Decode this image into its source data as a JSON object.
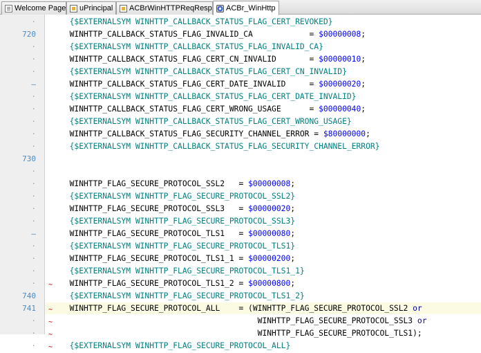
{
  "tabs": [
    {
      "label": "Welcome Page",
      "icon": "page-icon"
    },
    {
      "label": "uPrincipal",
      "icon": "unit-icon"
    },
    {
      "label": "ACBrWinHTTPReqResp",
      "icon": "unit-icon"
    },
    {
      "label": "ACBr_WinHttp",
      "icon": "gear-unit-icon",
      "active": true
    }
  ],
  "gutter": {
    "line_numbers": [
      "·",
      "720",
      "·",
      "·",
      "·",
      "–",
      "·",
      "·",
      "·",
      "·",
      "·",
      "730",
      "·",
      "·",
      "·",
      "·",
      "·",
      "–",
      "·",
      "·",
      "·",
      "·",
      "740",
      "741",
      "·",
      "·",
      "·"
    ]
  },
  "code": {
    "lines": [
      {
        "parts": [
          {
            "t": "  {$EXTERNALSYM WINHTTP_CALLBACK_STATUS_FLAG_CERT_REVOKED}",
            "c": "cm"
          }
        ]
      },
      {
        "parts": [
          {
            "t": "  WINHTTP_CALLBACK_STATUS_FLAG_INVALID_CA            = ",
            "c": ""
          },
          {
            "t": "$00000008",
            "c": "num"
          },
          {
            "t": ";",
            "c": ""
          }
        ]
      },
      {
        "parts": [
          {
            "t": "  {$EXTERNALSYM WINHTTP_CALLBACK_STATUS_FLAG_INVALID_CA}",
            "c": "cm"
          }
        ]
      },
      {
        "parts": [
          {
            "t": "  WINHTTP_CALLBACK_STATUS_FLAG_CERT_CN_INVALID       = ",
            "c": ""
          },
          {
            "t": "$00000010",
            "c": "num"
          },
          {
            "t": ";",
            "c": ""
          }
        ]
      },
      {
        "parts": [
          {
            "t": "  {$EXTERNALSYM WINHTTP_CALLBACK_STATUS_FLAG_CERT_CN_INVALID}",
            "c": "cm"
          }
        ]
      },
      {
        "parts": [
          {
            "t": "  WINHTTP_CALLBACK_STATUS_FLAG_CERT_DATE_INVALID     = ",
            "c": ""
          },
          {
            "t": "$00000020",
            "c": "num"
          },
          {
            "t": ";",
            "c": ""
          }
        ]
      },
      {
        "parts": [
          {
            "t": "  {$EXTERNALSYM WINHTTP_CALLBACK_STATUS_FLAG_CERT_DATE_INVALID}",
            "c": "cm"
          }
        ]
      },
      {
        "parts": [
          {
            "t": "  WINHTTP_CALLBACK_STATUS_FLAG_CERT_WRONG_USAGE      = ",
            "c": ""
          },
          {
            "t": "$00000040",
            "c": "num"
          },
          {
            "t": ";",
            "c": ""
          }
        ]
      },
      {
        "parts": [
          {
            "t": "  {$EXTERNALSYM WINHTTP_CALLBACK_STATUS_FLAG_CERT_WRONG_USAGE}",
            "c": "cm"
          }
        ]
      },
      {
        "parts": [
          {
            "t": "  WINHTTP_CALLBACK_STATUS_FLAG_SECURITY_CHANNEL_ERROR = ",
            "c": ""
          },
          {
            "t": "$80000000",
            "c": "num"
          },
          {
            "t": ";",
            "c": ""
          }
        ]
      },
      {
        "parts": [
          {
            "t": "  {$EXTERNALSYM WINHTTP_CALLBACK_STATUS_FLAG_SECURITY_CHANNEL_ERROR}",
            "c": "cm"
          }
        ]
      },
      {
        "parts": []
      },
      {
        "parts": []
      },
      {
        "parts": [
          {
            "t": "  WINHTTP_FLAG_SECURE_PROTOCOL_SSL2   = ",
            "c": ""
          },
          {
            "t": "$00000008",
            "c": "num"
          },
          {
            "t": ";",
            "c": ""
          }
        ]
      },
      {
        "parts": [
          {
            "t": "  {$EXTERNALSYM WINHTTP_FLAG_SECURE_PROTOCOL_SSL2}",
            "c": "cm"
          }
        ]
      },
      {
        "parts": [
          {
            "t": "  WINHTTP_FLAG_SECURE_PROTOCOL_SSL3   = ",
            "c": ""
          },
          {
            "t": "$00000020",
            "c": "num"
          },
          {
            "t": ";",
            "c": ""
          }
        ]
      },
      {
        "parts": [
          {
            "t": "  {$EXTERNALSYM WINHTTP_FLAG_SECURE_PROTOCOL_SSL3}",
            "c": "cm"
          }
        ]
      },
      {
        "parts": [
          {
            "t": "  WINHTTP_FLAG_SECURE_PROTOCOL_TLS1   = ",
            "c": ""
          },
          {
            "t": "$00000080",
            "c": "num"
          },
          {
            "t": ";",
            "c": ""
          }
        ]
      },
      {
        "parts": [
          {
            "t": "  {$EXTERNALSYM WINHTTP_FLAG_SECURE_PROTOCOL_TLS1}",
            "c": "cm"
          }
        ]
      },
      {
        "parts": [
          {
            "t": "  WINHTTP_FLAG_SECURE_PROTOCOL_TLS1_1 = ",
            "c": ""
          },
          {
            "t": "$00000200",
            "c": "num"
          },
          {
            "t": ";",
            "c": ""
          }
        ]
      },
      {
        "parts": [
          {
            "t": "  {$EXTERNALSYM WINHTTP_FLAG_SECURE_PROTOCOL_TLS1_1}",
            "c": "cm"
          }
        ]
      },
      {
        "parts": [
          {
            "t": "  WINHTTP_FLAG_SECURE_PROTOCOL_TLS1_2 = ",
            "c": ""
          },
          {
            "t": "$00000800",
            "c": "num"
          },
          {
            "t": ";",
            "c": ""
          }
        ]
      },
      {
        "parts": [
          {
            "t": "  {$EXTERNALSYM WINHTTP_FLAG_SECURE_PROTOCOL_TLS1_2}",
            "c": "cm"
          }
        ]
      },
      {
        "parts": [
          {
            "t": "  WINHTTP_FLAG_SECURE_PROTOCOL_ALL    = (WINHTTP_FLAG_SECURE_PROTOCOL_SSL2 ",
            "c": ""
          },
          {
            "t": "or",
            "c": "kw"
          }
        ]
      },
      {
        "parts": [
          {
            "t": "                                          WINHTTP_FLAG_SECURE_PROTOCOL_SSL3 ",
            "c": ""
          },
          {
            "t": "or",
            "c": "kw"
          }
        ]
      },
      {
        "parts": [
          {
            "t": "                                          WINHTTP_FLAG_SECURE_PROTOCOL_TLS1);",
            "c": ""
          }
        ]
      },
      {
        "parts": [
          {
            "t": "  {$EXTERNALSYM WINHTTP_FLAG_SECURE_PROTOCOL_ALL}",
            "c": "cm"
          }
        ]
      }
    ],
    "squiggle_lines": [
      21,
      23,
      24,
      25,
      26
    ],
    "highlighted_line": 23
  },
  "colors": {
    "comment": "#008080",
    "number": "#0000ff",
    "keyword": "#0000a0",
    "line_number": "#4c8ac2",
    "gutter_bg": "#efefef",
    "current_line_bg": "#fbfbe4"
  }
}
